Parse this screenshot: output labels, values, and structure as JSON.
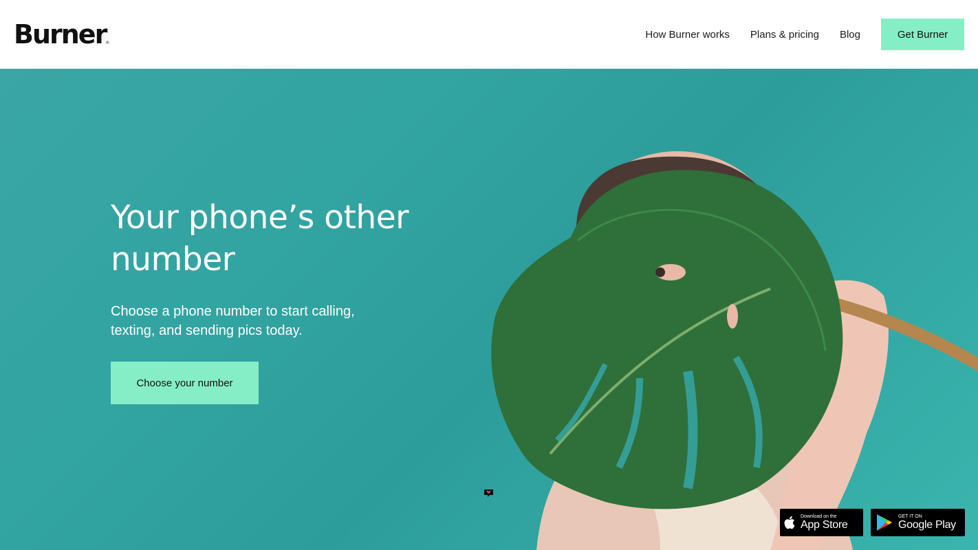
{
  "header": {
    "logo": "Burner",
    "logo_mark": "®",
    "nav": {
      "how": "How Burner works",
      "plans": "Plans & pricing",
      "blog": "Blog",
      "cta": "Get Burner"
    }
  },
  "hero": {
    "headline": "Your phone’s other number",
    "subheadline": "Choose a phone number to start calling, texting, and sending pics today.",
    "button": "Choose your number",
    "image_description_icon": "person-with-monstera-leaf"
  },
  "stores": {
    "apple": {
      "small": "Download on the",
      "big": "App Store",
      "icon": "apple-icon"
    },
    "google": {
      "small": "GET IT ON",
      "big": "Google Play",
      "icon": "google-play-icon"
    }
  },
  "colors": {
    "accent": "#86eec6",
    "hero_bg": "#35a3a1",
    "text_dark": "#111111"
  }
}
